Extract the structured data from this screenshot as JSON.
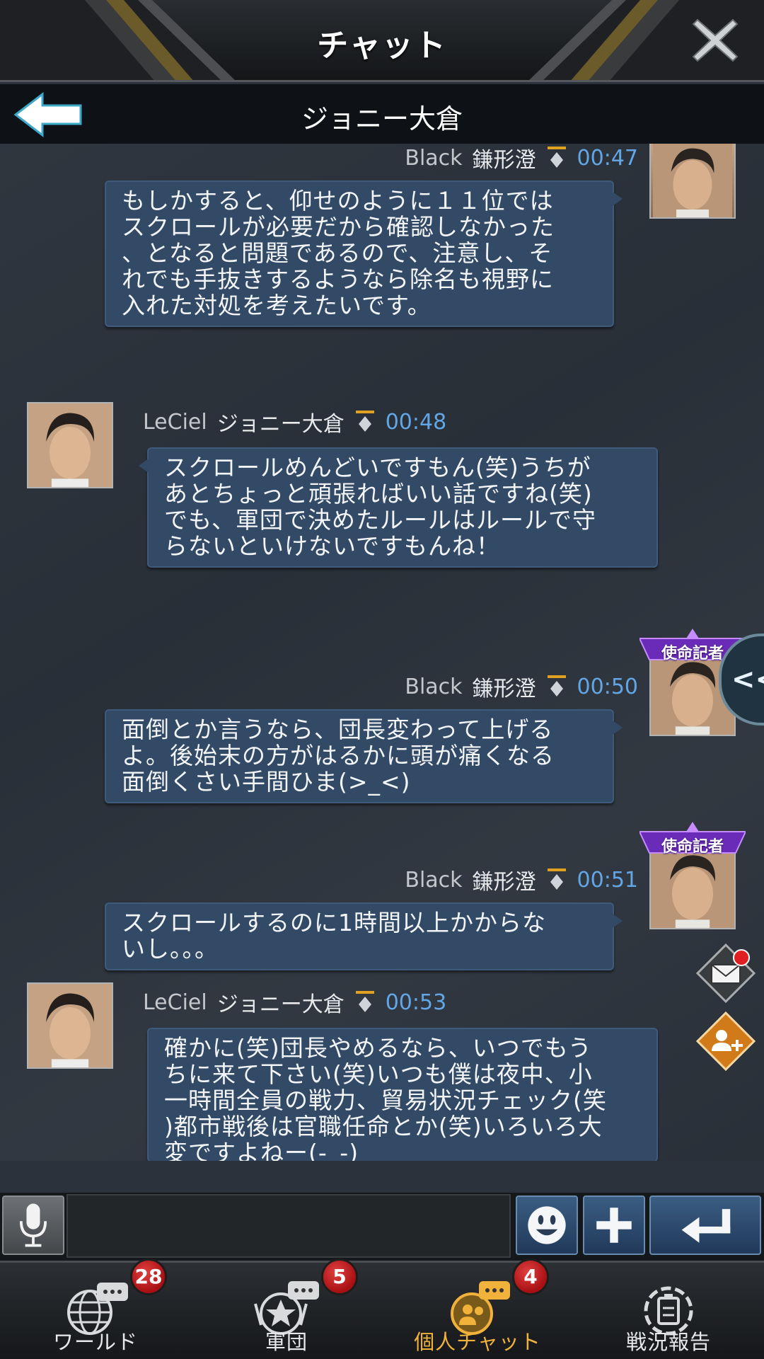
{
  "header": {
    "title": "チャット",
    "partner_name": "ジョニー大倉"
  },
  "messages": [
    {
      "side": "right",
      "tag": "Black",
      "nick": "鎌形澄",
      "time": "00:47",
      "badge": "",
      "text": "もしかすると、仰せのように１１位では\nスクロールが必要だから確認しなかった\n、となると問題であるので、注意し、そ\nれでも手抜きするようなら除名も視野に\n入れた対処を考えたいです。"
    },
    {
      "side": "left",
      "tag": "LeCiel",
      "nick": "ジョニー大倉",
      "time": "00:48",
      "text": "スクロールめんどいですもん(笑)うちが\nあとちょっと頑張ればいい話ですね(笑)\nでも、軍団で決めたルールはルールで守\nらないといけないですもんね！"
    },
    {
      "side": "right",
      "tag": "Black",
      "nick": "鎌形澄",
      "time": "00:50",
      "badge": "使命記者",
      "text": "面倒とか言うなら、団長変わって上げる\nよ。後始末の方がはるかに頭が痛くなる\n面倒くさい手間ひま(>_<)"
    },
    {
      "side": "right",
      "tag": "Black",
      "nick": "鎌形澄",
      "time": "00:51",
      "badge": "使命記者",
      "text": "スクロールするのに1時間以上かからな\nいし。。。"
    },
    {
      "side": "left",
      "tag": "LeCiel",
      "nick": "ジョニー大倉",
      "time": "00:53",
      "text": "確かに(笑)団長やめるなら、いつでもう\nちに来て下さい(笑)いつも僕は夜中、小\n一時間全員の戦力、貿易状況チェック(笑\n)都市戦後は官職任命とか(笑)いろいろ大\n変ですよねー(-_-)"
    }
  ],
  "side_tab": {
    "label": "<<"
  },
  "input": {
    "value": "",
    "placeholder": ""
  },
  "nav": [
    {
      "label": "ワールド",
      "count": "28",
      "icon": "world-chat-icon"
    },
    {
      "label": "軍団",
      "count": "5",
      "icon": "legion-chat-icon"
    },
    {
      "label": "個人チャット",
      "count": "4",
      "icon": "private-chat-icon",
      "active": true
    },
    {
      "label": "戦況報告",
      "count": "",
      "icon": "battle-report-icon"
    }
  ],
  "colors": {
    "background": "#2b323b",
    "bubble": "#324a66",
    "time": "#63a6e6",
    "active_tab": "#f0b23a",
    "badge_purple": "#8a3fd6",
    "count_red": "#c81b1e"
  }
}
